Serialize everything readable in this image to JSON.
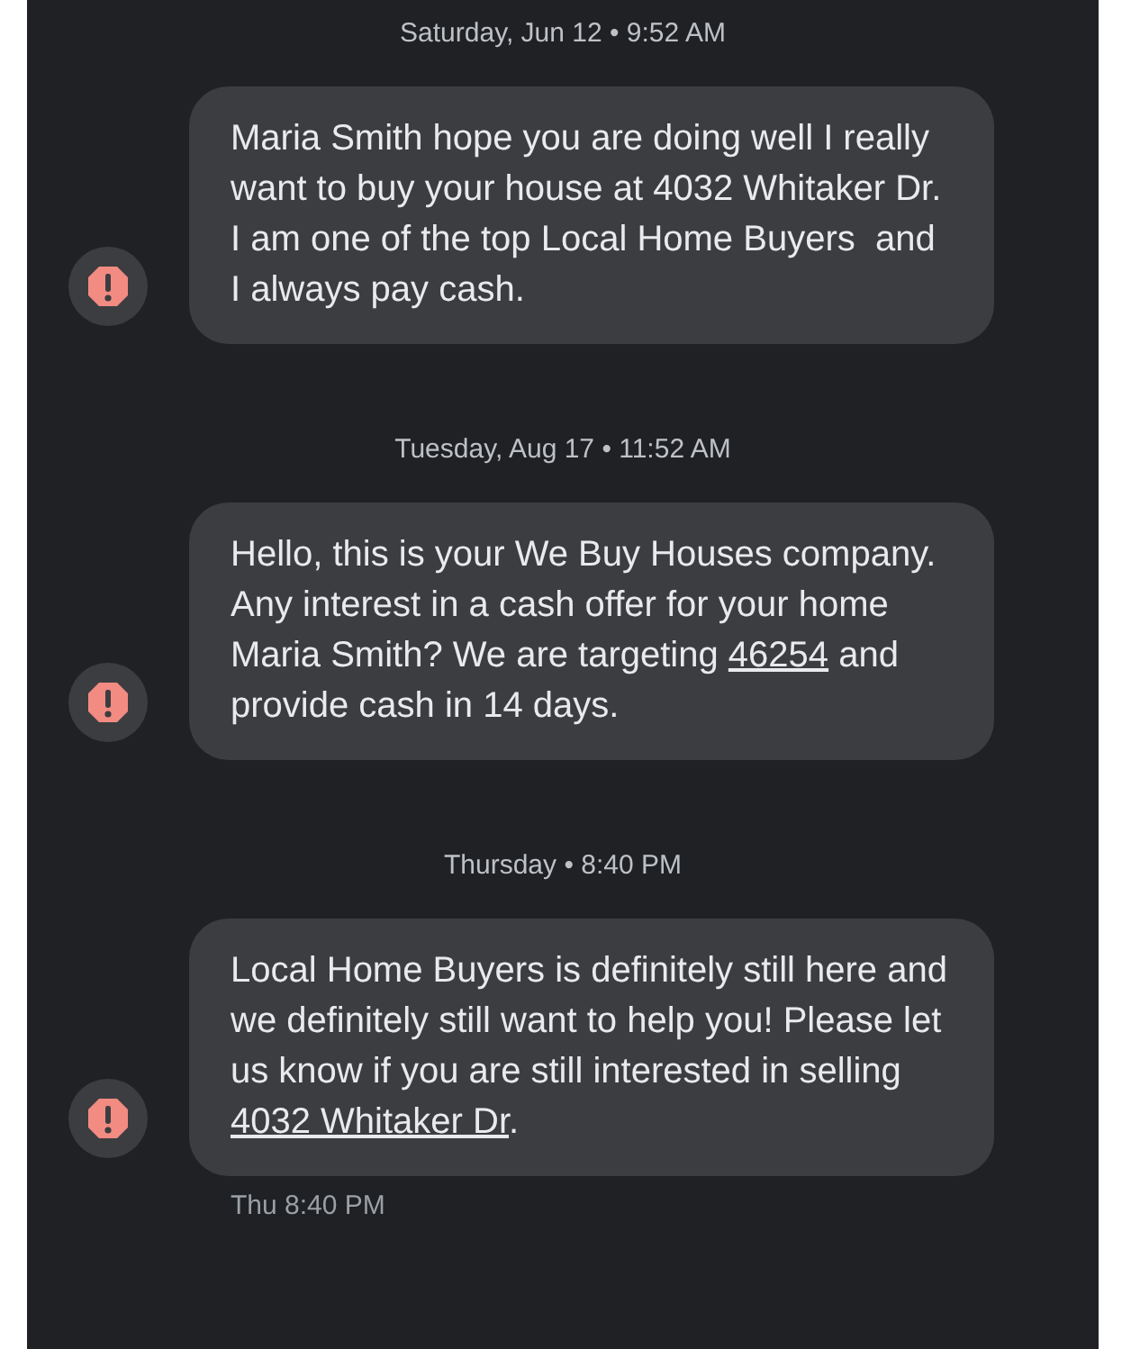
{
  "messages": [
    {
      "timestamp": "Saturday, Jun 12 • 9:52 AM",
      "error": true,
      "parts": [
        {
          "text": "Maria Smith hope you are doing well I really want to buy your house at 4032 Whitaker Dr. I am one of the top Local Home Buyers  and I always pay cash.",
          "kind": "text"
        }
      ]
    },
    {
      "timestamp": "Tuesday, Aug 17 • 11:52 AM",
      "error": true,
      "parts": [
        {
          "text": "Hello, this is your We Buy Houses company. Any interest in a cash offer for your home Maria Smith? We are targeting ",
          "kind": "text"
        },
        {
          "text": "46254",
          "kind": "link"
        },
        {
          "text": " and provide cash in 14 days.",
          "kind": "text"
        }
      ]
    },
    {
      "timestamp": "Thursday • 8:40 PM",
      "error": true,
      "parts": [
        {
          "text": "Local Home Buyers is definitely still here and we definitely still want to help you! Please let us know if you are still interested in selling ",
          "kind": "text"
        },
        {
          "text": "4032 Whitaker Dr",
          "kind": "link"
        },
        {
          "text": ".",
          "kind": "text"
        }
      ]
    }
  ],
  "last_time": "Thu 8:40 PM"
}
